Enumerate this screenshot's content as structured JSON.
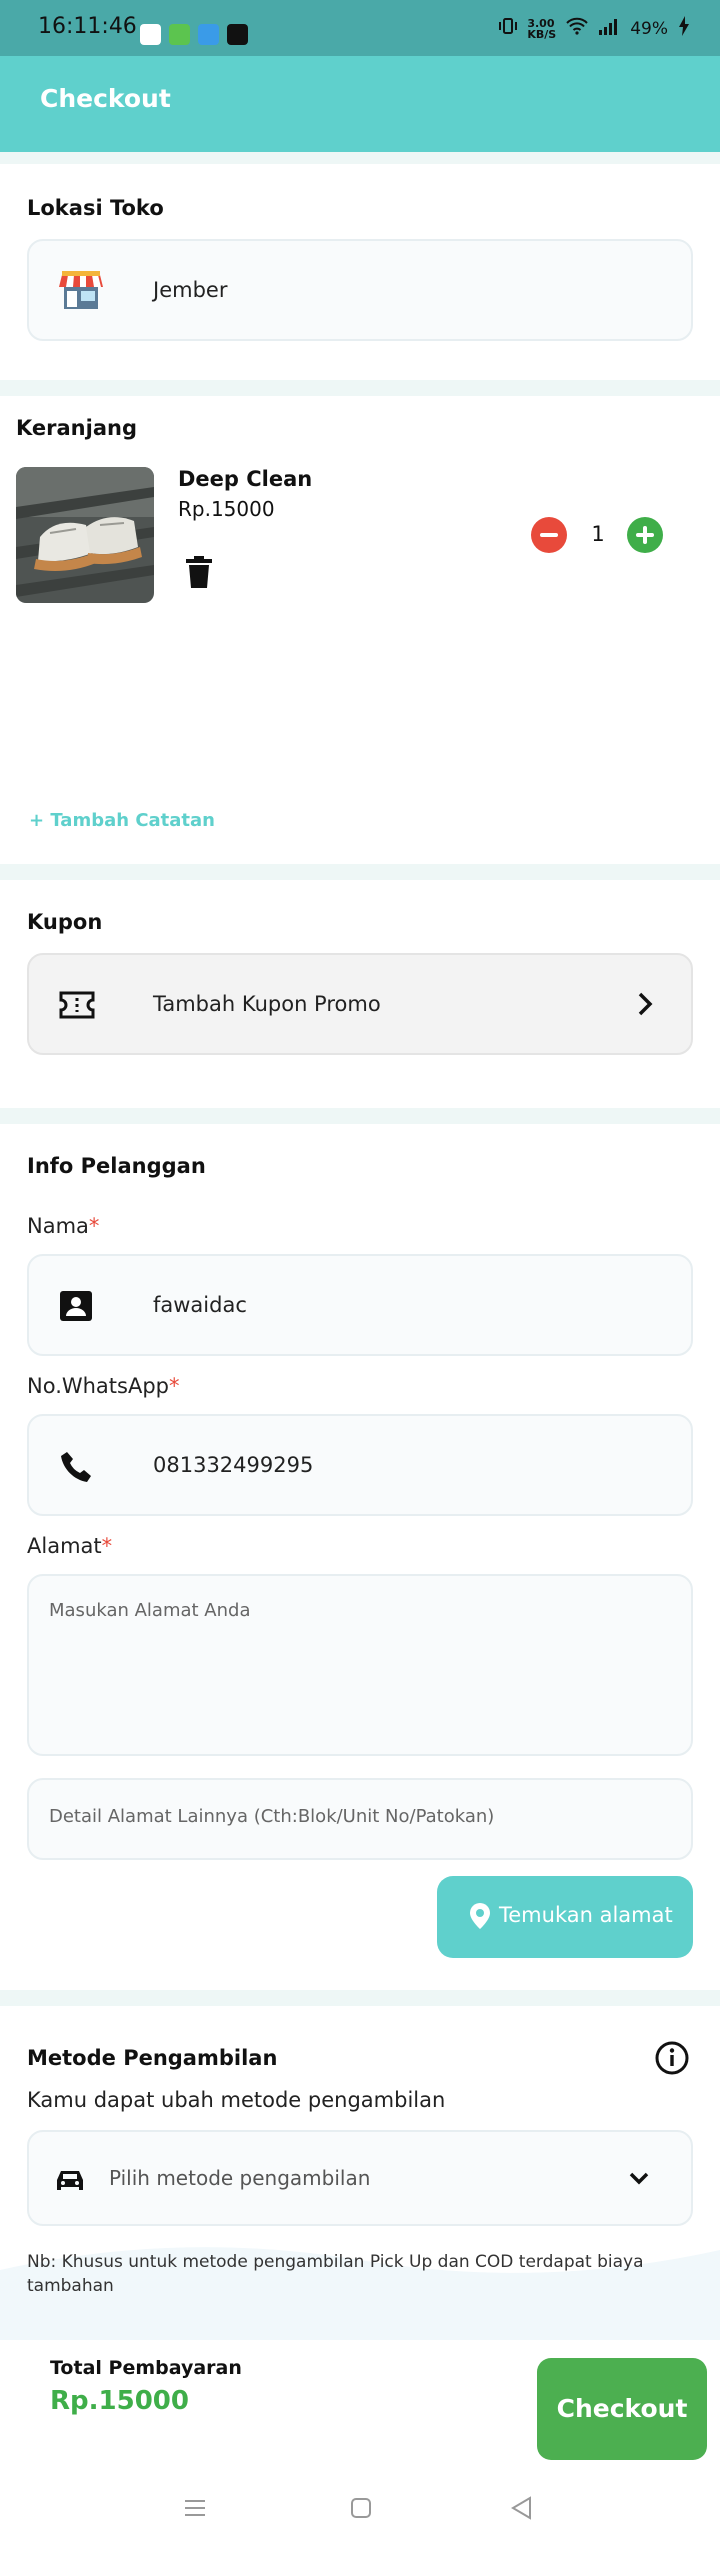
{
  "status_bar": {
    "time": "16:11:46",
    "network_speed_value": "3.00",
    "network_speed_unit": "KB/S",
    "battery": "49%"
  },
  "app_bar": {
    "title": "Checkout"
  },
  "store": {
    "title": "Lokasi Toko",
    "location": "Jember"
  },
  "cart": {
    "title": "Keranjang",
    "items": [
      {
        "name": "Deep Clean",
        "price": "Rp.15000",
        "quantity": "1"
      }
    ],
    "add_note": "+ Tambah Catatan"
  },
  "coupon": {
    "title": "Kupon",
    "label": "Tambah Kupon Promo"
  },
  "customer": {
    "title": "Info Pelanggan",
    "name_label": "Nama",
    "name_value": "fawaidac",
    "phone_label": "No.WhatsApp",
    "phone_value": "081332499295",
    "address_label": "Alamat",
    "required_mark": "*",
    "address_placeholder": "Masukan Alamat Anda",
    "address_detail_placeholder": "Detail Alamat Lainnya (Cth:Blok/Unit No/Patokan)",
    "find_address_button": "Temukan alamat"
  },
  "pickup": {
    "title": "Metode Pengambilan",
    "subtitle": "Kamu dapat ubah metode pengambilan",
    "select_placeholder": "Pilih metode pengambilan",
    "note": "Nb: Khusus untuk metode pengambilan Pick Up dan COD terdapat biaya tambahan"
  },
  "footer": {
    "total_label": "Total Pembayaran",
    "total_value": "Rp.15000",
    "checkout_button": "Checkout"
  },
  "colors": {
    "accent": "#5fd0cc",
    "status_bar": "#4aa9a8",
    "minus": "#e84a3b",
    "plus": "#3fae49",
    "checkout": "#4caf50"
  }
}
